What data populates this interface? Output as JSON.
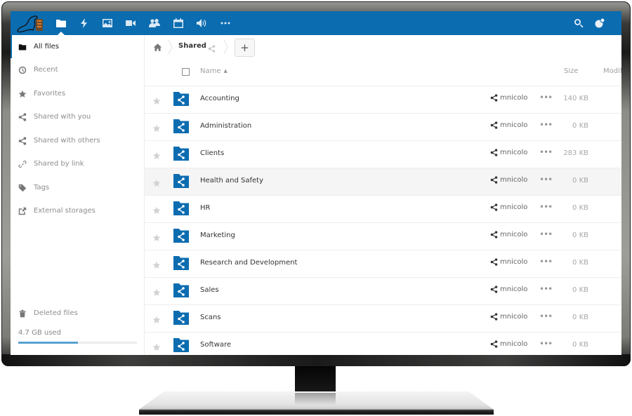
{
  "topbar": {
    "apps": [
      {
        "name": "files",
        "icon": "folder-icon",
        "active": true
      },
      {
        "name": "activity",
        "icon": "lightning-icon"
      },
      {
        "name": "gallery",
        "icon": "image-icon"
      },
      {
        "name": "video",
        "icon": "video-camera-icon"
      },
      {
        "name": "contacts",
        "icon": "contacts-icon"
      },
      {
        "name": "calendar",
        "icon": "calendar-icon"
      },
      {
        "name": "audio",
        "icon": "speaker-icon"
      },
      {
        "name": "more",
        "icon": "more-apps-icon"
      }
    ],
    "right_icons": [
      "search-icon",
      "user-avatar-icon"
    ],
    "brand_color": "#0b6cb0"
  },
  "sidebar": {
    "items": [
      {
        "label": "All files",
        "icon": "folder-icon",
        "active": true
      },
      {
        "label": "Recent",
        "icon": "clock-icon"
      },
      {
        "label": "Favorites",
        "icon": "star-icon"
      },
      {
        "label": "Shared with you",
        "icon": "share-icon"
      },
      {
        "label": "Shared with others",
        "icon": "share-icon"
      },
      {
        "label": "Shared by link",
        "icon": "link-icon"
      },
      {
        "label": "Tags",
        "icon": "tag-icon"
      },
      {
        "label": "External storages",
        "icon": "external-storage-icon"
      }
    ],
    "deleted_files": {
      "label": "Deleted files",
      "icon": "trash-icon"
    },
    "quota": {
      "label": "4.7 GB used",
      "fraction": 0.5
    }
  },
  "breadcrumb": {
    "home_icon": "home-icon",
    "current": "Shared",
    "new_button": "+"
  },
  "table": {
    "columns": {
      "name": "Name",
      "size": "Size",
      "modified": "Modif"
    },
    "rows": [
      {
        "name": "Accounting",
        "owner": "mnicolo",
        "size": "140 KB"
      },
      {
        "name": "Administration",
        "owner": "mnicolo",
        "size": "0 KB"
      },
      {
        "name": "Clients",
        "owner": "mnicolo",
        "size": "283 KB"
      },
      {
        "name": "Health and Safety",
        "owner": "mnicolo",
        "size": "0 KB",
        "hovered": true
      },
      {
        "name": "HR",
        "owner": "mnicolo",
        "size": "0 KB"
      },
      {
        "name": "Marketing",
        "owner": "mnicolo",
        "size": "0 KB"
      },
      {
        "name": "Research and Development",
        "owner": "mnicolo",
        "size": "0 KB"
      },
      {
        "name": "Sales",
        "owner": "mnicolo",
        "size": "0 KB"
      },
      {
        "name": "Scans",
        "owner": "mnicolo",
        "size": "0 KB"
      },
      {
        "name": "Software",
        "owner": "mnicolo",
        "size": "0 KB"
      }
    ],
    "more_label": "•••"
  }
}
